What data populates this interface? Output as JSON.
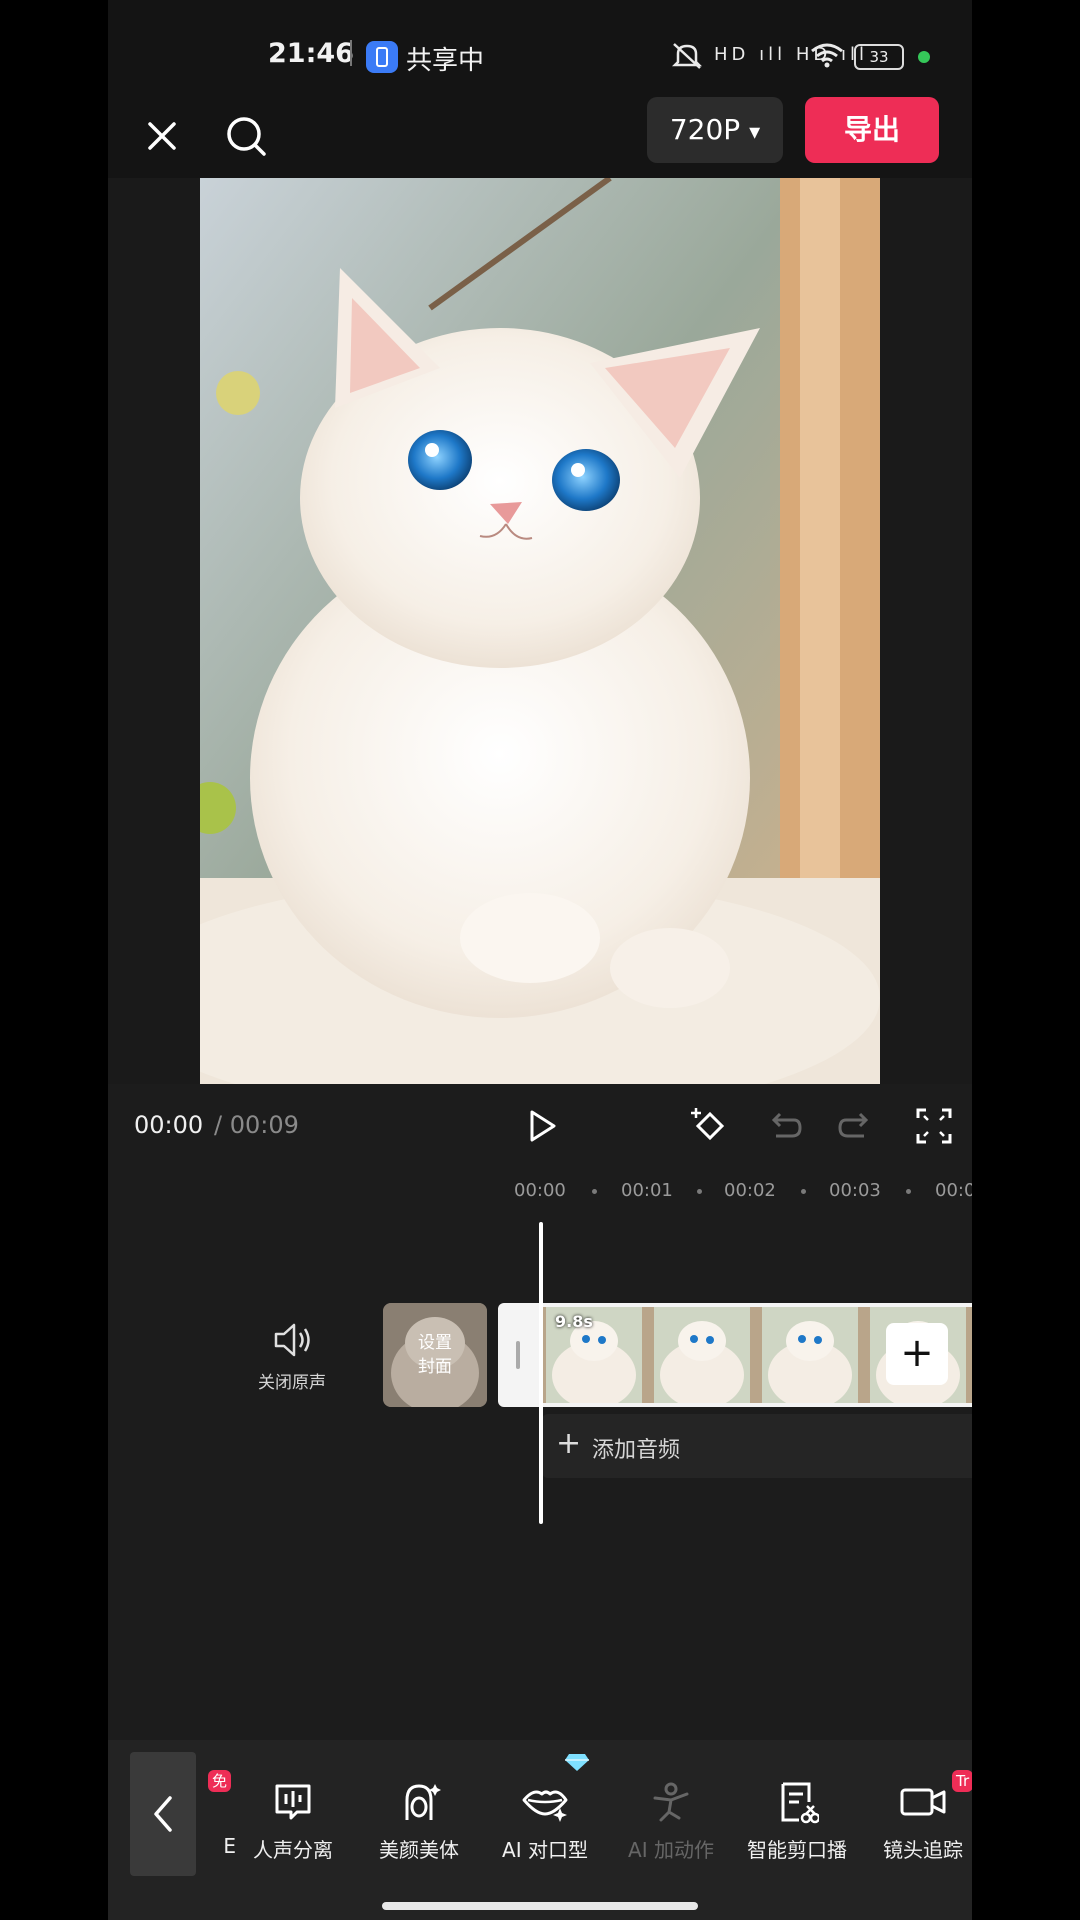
{
  "status_bar": {
    "time": "21:46",
    "share_label": "共享中",
    "signal_text": "HD ıll HD ıll",
    "battery": "33"
  },
  "top_bar": {
    "resolution": "720P",
    "resolution_arrow": "▾",
    "export": "导出"
  },
  "player": {
    "current_time": "00:00",
    "total_time": "/ 00:09"
  },
  "timeline": {
    "ruler": [
      "00:00",
      "00:01",
      "00:02",
      "00:03",
      "00:0"
    ],
    "mute_label": "关闭原声",
    "cover_label": "设置\n封面",
    "clip_duration": "9.8s",
    "add_clip": "+",
    "add_audio_plus": "+",
    "add_audio": "添加音频"
  },
  "toolbar": {
    "items": [
      {
        "label": "E",
        "icon": "partial-icon",
        "badge": "免"
      },
      {
        "label": "人声分离",
        "icon": "voice-separation-icon"
      },
      {
        "label": "美颜美体",
        "icon": "beauty-icon"
      },
      {
        "label": "AI 对口型",
        "icon": "lips-icon"
      },
      {
        "label": "AI 加动作",
        "icon": "ai-motion-icon"
      },
      {
        "label": "智能剪口播",
        "icon": "smart-cut-icon"
      },
      {
        "label": "镜头追踪",
        "icon": "camera-tracking-icon",
        "badge": "Tr"
      }
    ]
  },
  "colors": {
    "accent": "#ee2d56",
    "background": "#1c1c1c",
    "panel": "#232323"
  }
}
